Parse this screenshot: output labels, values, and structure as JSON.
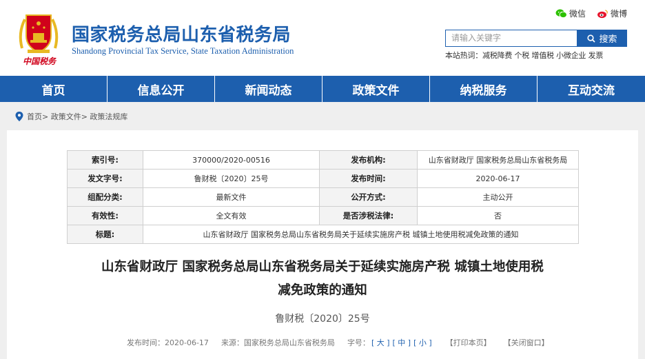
{
  "header": {
    "title": "国家税务总局山东省税务局",
    "subtitle": "Shandong Provincial Tax Service, State Taxation Administration",
    "emblem_text": "中国税务",
    "share": {
      "wechat": "微信",
      "weibo": "微博"
    },
    "search": {
      "placeholder": "请输入关键字",
      "button": "搜索"
    },
    "hot_words": "本站热词：减税降费 个税 增值税 小微企业 发票"
  },
  "nav": {
    "items": [
      "首页",
      "信息公开",
      "新闻动态",
      "政策文件",
      "纳税服务",
      "互动交流"
    ]
  },
  "breadcrumb": "首页> 政策文件> 政策法规库",
  "meta": {
    "index_label": "索引号:",
    "index_value": "370000/2020-00516",
    "org_label": "发布机构:",
    "org_value": "山东省财政厅 国家税务总局山东省税务局",
    "docno_label": "发文字号:",
    "docno_value": "鲁财税〔2020〕25号",
    "date_label": "发布时间:",
    "date_value": "2020-06-17",
    "category_label": "组配分类:",
    "category_value": "最新文件",
    "open_label": "公开方式:",
    "open_value": "主动公开",
    "validity_label": "有效性:",
    "validity_value": "全文有效",
    "law_label": "是否涉税法律:",
    "law_value": "否",
    "title_label": "标题:",
    "title_value": "山东省财政厅 国家税务总局山东省税务局关于延续实施房产税 城镇土地使用税减免政策的通知"
  },
  "document": {
    "title_line1": "山东省财政厅 国家税务总局山东省税务局关于延续实施房产税 城镇土地使用税",
    "title_line2": "减免政策的通知",
    "number": "鲁财税〔2020〕25号",
    "publish_time": "发布时间：2020-06-17",
    "source": "来源：国家税务总局山东省税务局",
    "font_label": "字号：",
    "font_large": "[ 大 ]",
    "font_medium": "[ 中 ]",
    "font_small": "[ 小 ]",
    "print": "【打印本页】",
    "close": "【关闭窗口】"
  },
  "colors": {
    "brand": "#1d5fae",
    "emblem_red": "#d0021b",
    "gold": "#e8b923"
  }
}
